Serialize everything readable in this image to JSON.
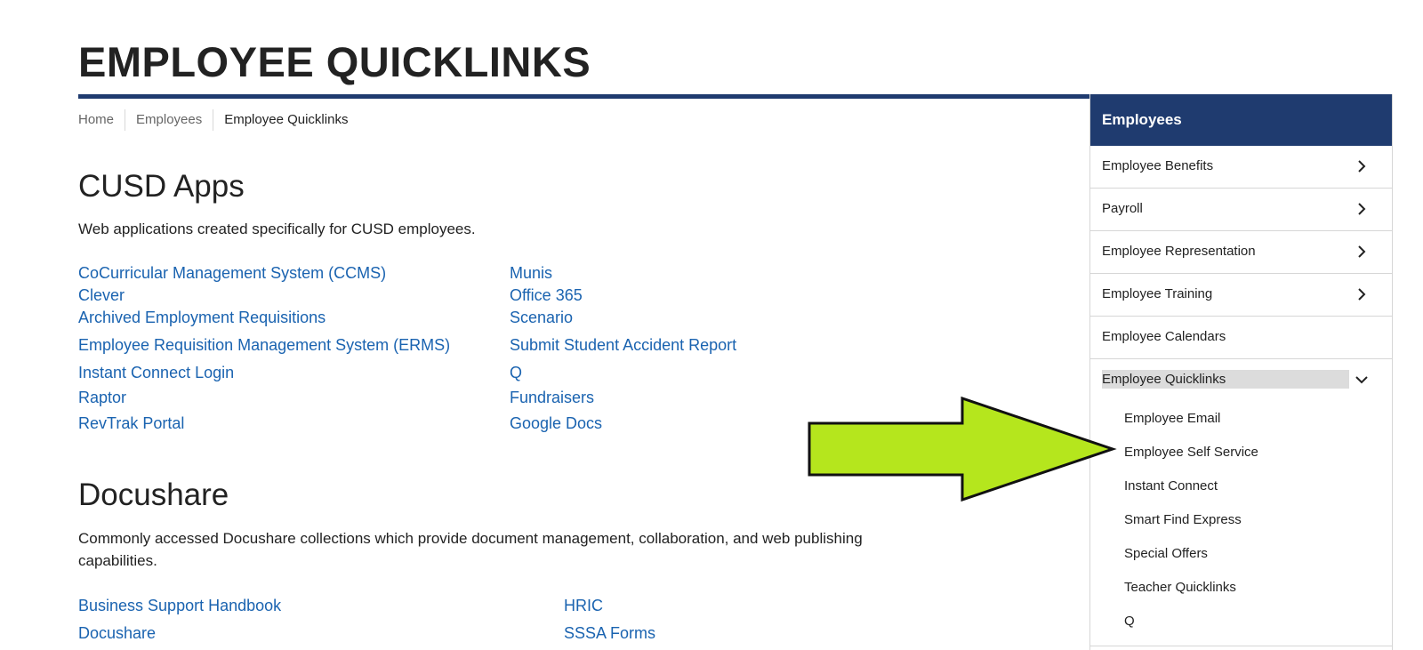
{
  "page": {
    "title": "EMPLOYEE QUICKLINKS"
  },
  "breadcrumb": [
    "Home",
    "Employees",
    "Employee Quicklinks"
  ],
  "apps": {
    "heading": "CUSD Apps",
    "description": "Web applications created specifically for CUSD employees.",
    "left_links": [
      "CoCurricular Management System (CCMS)",
      "Clever",
      "Archived Employment Requisitions",
      "Employee Requisition Management System (ERMS)",
      "Instant Connect Login",
      "Raptor",
      "RevTrak Portal"
    ],
    "right_links": [
      "Munis",
      "Office 365",
      "Scenario",
      "Submit Student Accident Report",
      "Q",
      "Fundraisers",
      "Google Docs"
    ]
  },
  "docushare": {
    "heading": "Docushare",
    "description_line1": "Commonly accessed Docushare collections which provide document management, collaboration, and web publishing",
    "description_line2": "capabilities.",
    "left_links": [
      "Business Support Handbook",
      "Docushare"
    ],
    "right_links": [
      "HRIC",
      "SSSA Forms"
    ]
  },
  "sidebar": {
    "header": "Employees",
    "items": [
      {
        "label": "Employee Benefits",
        "icon": "chevron-right-icon"
      },
      {
        "label": "Payroll",
        "icon": "chevron-right-icon"
      },
      {
        "label": "Employee Representation",
        "icon": "chevron-right-icon"
      },
      {
        "label": "Employee Training",
        "icon": "chevron-right-icon"
      },
      {
        "label": "Employee Calendars",
        "icon": ""
      },
      {
        "label": "Employee Quicklinks",
        "icon": "chevron-down-icon"
      }
    ],
    "subitems": [
      "Employee Email",
      "Employee Self Service",
      "Instant Connect",
      "Smart Find Express",
      "Special Offers",
      "Teacher Quicklinks",
      "Q"
    ]
  },
  "colors": {
    "brand_navy": "#1f3b6f",
    "link_blue": "#1a63b0",
    "arrow_green": "#b5e61d"
  }
}
